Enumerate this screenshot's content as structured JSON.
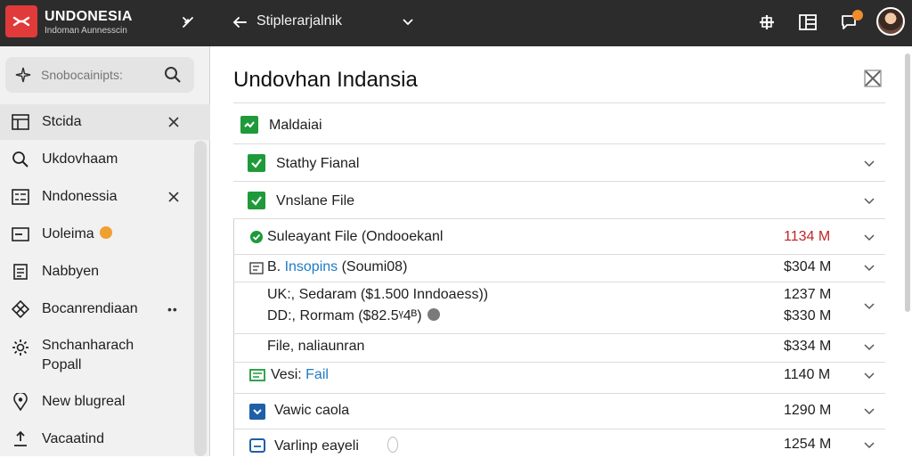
{
  "header": {
    "brand": "UNDONESIA",
    "brand_sub": "Indoman Aunnesscin",
    "title": "Stiplerarjalnik"
  },
  "sidebar": {
    "search_placeholder": "Snobocainipts:",
    "items": [
      {
        "label": "Stcida",
        "icon": "table-icon",
        "close": true
      },
      {
        "label": "Ukdovhaam",
        "icon": "search-icon"
      },
      {
        "label": "Nndonessia",
        "icon": "list-icon",
        "close": true
      },
      {
        "label": "Uoleima",
        "icon": "card-icon",
        "badge": true
      },
      {
        "label": "Nabbyen",
        "icon": "document-icon"
      },
      {
        "label": "Bocanrendiaan",
        "icon": "grid-icon",
        "more": "••"
      },
      {
        "label": "Snchanharach",
        "label2": "Popall",
        "icon": "settings-icon"
      },
      {
        "label": "New blugreal",
        "icon": "location-icon"
      },
      {
        "label": "Vacaatind",
        "icon": "upload-icon"
      }
    ]
  },
  "main": {
    "heading": "Undovhan Indansia",
    "rows": [
      {
        "label": "Maldaiai"
      },
      {
        "label": "Stathy Fianal"
      },
      {
        "label": "Vnslane File"
      },
      {
        "label": "Suleayant File (Ondooekanl",
        "amount": "1134 M"
      },
      {
        "label_prefix": "B. ",
        "label_link": "Insopins",
        "label_suffix": " (Soumi08)",
        "amount": "$304 M"
      },
      {
        "label": "UK:, Sedaram ($1.500 Inndoaess))",
        "label2": "DD:, Rormam ($82.5ᵞ4ᴮ)",
        "amount": "1237 M",
        "amount2": "$330 M"
      },
      {
        "label": "File, naliaunran",
        "amount": "$334 M"
      },
      {
        "label_prefix": "Vesi: ",
        "label_link": "Fail",
        "amount": "1140 M"
      },
      {
        "label": "Vawic caola",
        "amount": "1290 M"
      },
      {
        "label": "Varlinp eayeli",
        "amount": "1254 M"
      }
    ]
  },
  "colors": {
    "topbar": "#2c2c2c",
    "logo": "#e13a3a",
    "check_green": "#1f9a3a",
    "check_blue": "#1e5fa8",
    "amount_red": "#c02626",
    "link": "#1e7bc4"
  }
}
